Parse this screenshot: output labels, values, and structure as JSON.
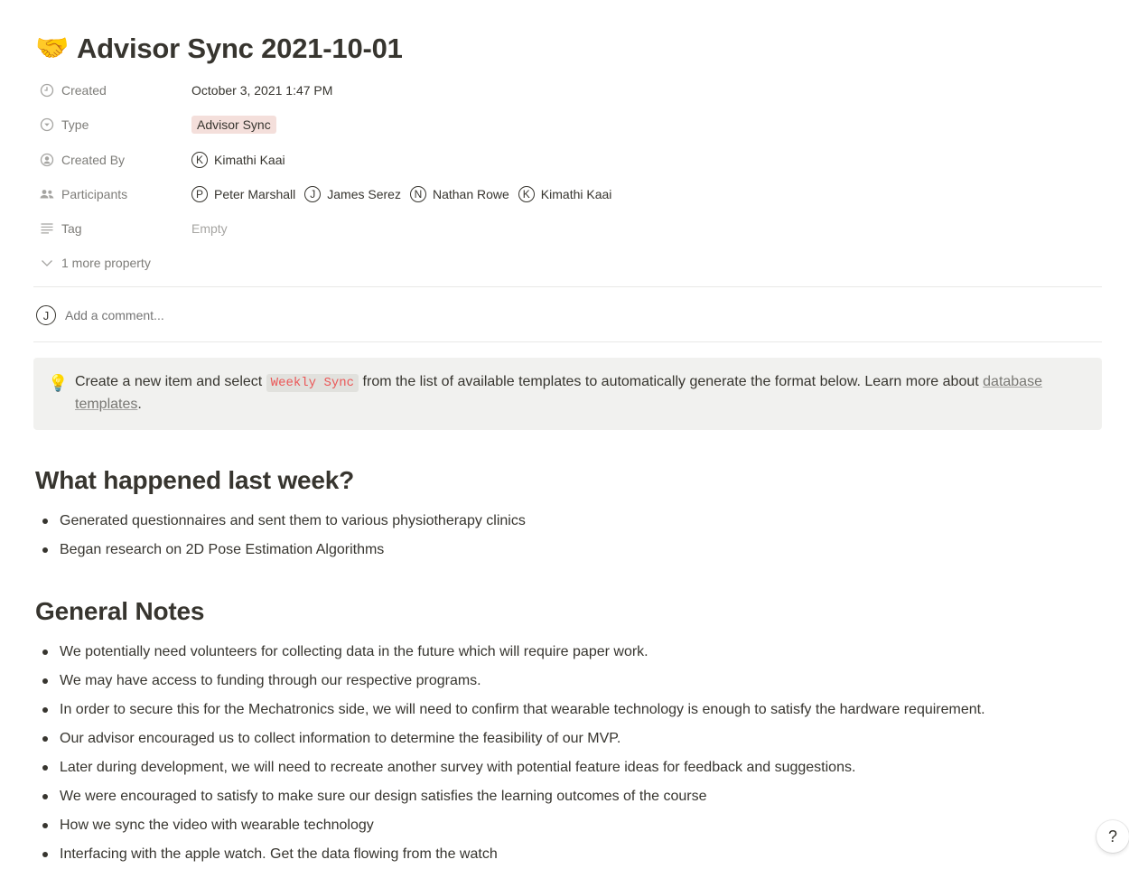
{
  "page": {
    "emoji": "🤝",
    "title": "Advisor Sync 2021-10-01"
  },
  "properties": {
    "created": {
      "name": "Created",
      "value": "October 3, 2021 1:47 PM",
      "icon": "clock-icon"
    },
    "type": {
      "name": "Type",
      "value": "Advisor Sync",
      "icon": "select-icon",
      "color": "#f4dfdb"
    },
    "created_by": {
      "name": "Created By",
      "icon": "person-icon",
      "people": [
        {
          "initial": "K",
          "name": "Kimathi Kaai"
        }
      ]
    },
    "participants": {
      "name": "Participants",
      "icon": "people-icon",
      "people": [
        {
          "initial": "P",
          "name": "Peter Marshall"
        },
        {
          "initial": "J",
          "name": "James Serez"
        },
        {
          "initial": "N",
          "name": "Nathan Rowe"
        },
        {
          "initial": "K",
          "name": "Kimathi Kaai"
        }
      ]
    },
    "tag": {
      "name": "Tag",
      "value": "Empty",
      "icon": "text-lines-icon"
    },
    "more": {
      "label": "1 more property",
      "icon": "chevron-down-icon"
    }
  },
  "comment": {
    "avatar_initial": "J",
    "placeholder": "Add a comment..."
  },
  "callout": {
    "icon": "lightbulb-icon",
    "emoji": "💡",
    "text_before": "Create a new item and select ",
    "code": "Weekly Sync",
    "text_after": " from the list of available templates to automatically generate the format below. Learn more about ",
    "link": "database templates",
    "text_end": "."
  },
  "sections": [
    {
      "heading": "What happened last week?",
      "bullets": [
        "Generated questionnaires and sent them to various physiotherapy clinics",
        "Began research on 2D Pose Estimation Algorithms"
      ]
    },
    {
      "heading": "General Notes",
      "bullets": [
        "We potentially need volunteers for collecting data in the future which will require paper work.",
        "We may have access to funding through our respective programs.",
        "In order to secure this for the Mechatronics side, we will need to confirm that wearable technology is enough to satisfy the hardware requirement.",
        "Our advisor encouraged us to collect information to determine the feasibility of our MVP.",
        "Later during development, we will need to recreate another survey with potential feature ideas for feedback and suggestions.",
        "We were encouraged to satisfy to make sure our design satisfies the learning outcomes of the course",
        "How we sync the video with wearable technology",
        "Interfacing with the apple watch. Get the data flowing from the watch"
      ]
    }
  ],
  "help": {
    "label": "?"
  }
}
